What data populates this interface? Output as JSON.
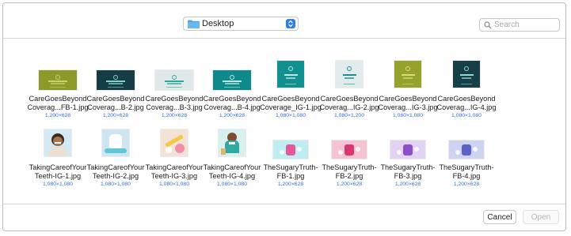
{
  "toolbar": {
    "location_label": "Desktop",
    "search_placeholder": "Search"
  },
  "files": [
    {
      "line1": "CareGoesBeyond",
      "line2": "Coverag...FB-1.jpg",
      "dims": "1,200×628",
      "kind": "wide",
      "bg": "#8c9a2a",
      "accent": "#c7d36b",
      "caption": "Let's Talk Options"
    },
    {
      "line1": "CareGoesBeyond",
      "line2": "Coverag...B-2.jpg",
      "dims": "1,200×628",
      "kind": "wide",
      "bg": "#163d45",
      "accent": "#7dd3c4",
      "caption": "Prevention Is Care"
    },
    {
      "line1": "CareGoesBeyond",
      "line2": "Coverag...B-3.jpg",
      "dims": "1,200×628",
      "kind": "wide",
      "bg": "#dfe9ea",
      "accent": "#2aa69b",
      "caption": "Detection Is Early"
    },
    {
      "line1": "CareGoesBeyond",
      "line2": "Coverag...B-4.jpg",
      "dims": "1,200×628",
      "kind": "wide",
      "bg": "#0f8a8c",
      "accent": "#bfe6e0",
      "caption": "It's All Connected"
    },
    {
      "line1": "CareGoesBeyond",
      "line2": "Coverage_IG-1.jpg",
      "dims": "1,080×1,080",
      "kind": "square",
      "bg": "#12908f",
      "accent": "#bfe9e3",
      "caption": "It's All Connected!"
    },
    {
      "line1": "CareGoesBeyond",
      "line2": "Coverag...IG-2.jpg",
      "dims": "1,080×1,200",
      "kind": "square",
      "bg": "#e1eaec",
      "accent": "#1f8f8a",
      "caption": "Detection Is Early"
    },
    {
      "line1": "CareGoesBeyond",
      "line2": "Coverag...IG-3.jpg",
      "dims": "1,080×1,080",
      "kind": "square",
      "bg": "#95a22c",
      "accent": "#d6de7a",
      "caption": "Let's Talk Options"
    },
    {
      "line1": "CareGoesBeyond",
      "line2": "Coverag...IG-4.jpg",
      "dims": "1,080×1,080",
      "kind": "square",
      "bg": "#173f47",
      "accent": "#8fd8cb",
      "caption": "Prevention Care Is Caring"
    },
    {
      "line1": "TakingCareofYour",
      "line2": "Teeth-IG-1.jpg",
      "dims": "1,080×1,080",
      "kind": "person",
      "bg": "#d3e9f3",
      "accent": "#6b4a32",
      "caption": ""
    },
    {
      "line1": "TakingCareofYour",
      "line2": "Teeth-IG-2.jpg",
      "dims": "1,080×1,080",
      "kind": "tooth",
      "bg": "#cfe6f2",
      "accent": "#5ec7d8",
      "caption": ""
    },
    {
      "line1": "TakingCareofYour",
      "line2": "Teeth-IG-3.jpg",
      "dims": "1,080×1,080",
      "kind": "brush",
      "bg": "#f3e3d6",
      "accent": "#f2c842",
      "caption": ""
    },
    {
      "line1": "TakingCareofYour",
      "line2": "Teeth-IG-4.jpg",
      "dims": "1,080×1,080",
      "kind": "dentist",
      "bg": "#d9f0ef",
      "accent": "#2fa9a2",
      "caption": ""
    },
    {
      "line1": "TheSugaryTruth-",
      "line2": "FB-1.jpg",
      "dims": "1,200×628",
      "kind": "candy",
      "bg": "#bfeef2",
      "accent": "#e3589b",
      "caption": ""
    },
    {
      "line1": "TheSugaryTruth-",
      "line2": "FB-2.jpg",
      "dims": "1,200×628",
      "kind": "candy",
      "bg": "#f6c3d3",
      "accent": "#d9376e",
      "caption": ""
    },
    {
      "line1": "TheSugaryTruth-",
      "line2": "FB-3.jpg",
      "dims": "1,200×628",
      "kind": "candy",
      "bg": "#e2d2f3",
      "accent": "#8c4fc9",
      "caption": ""
    },
    {
      "line1": "TheSugaryTruth-",
      "line2": "FB-4.jpg",
      "dims": "1,200×628",
      "kind": "candy",
      "bg": "#cfd3f2",
      "accent": "#5b63c8",
      "caption": ""
    }
  ],
  "footer": {
    "cancel_label": "Cancel",
    "open_label": "Open"
  }
}
